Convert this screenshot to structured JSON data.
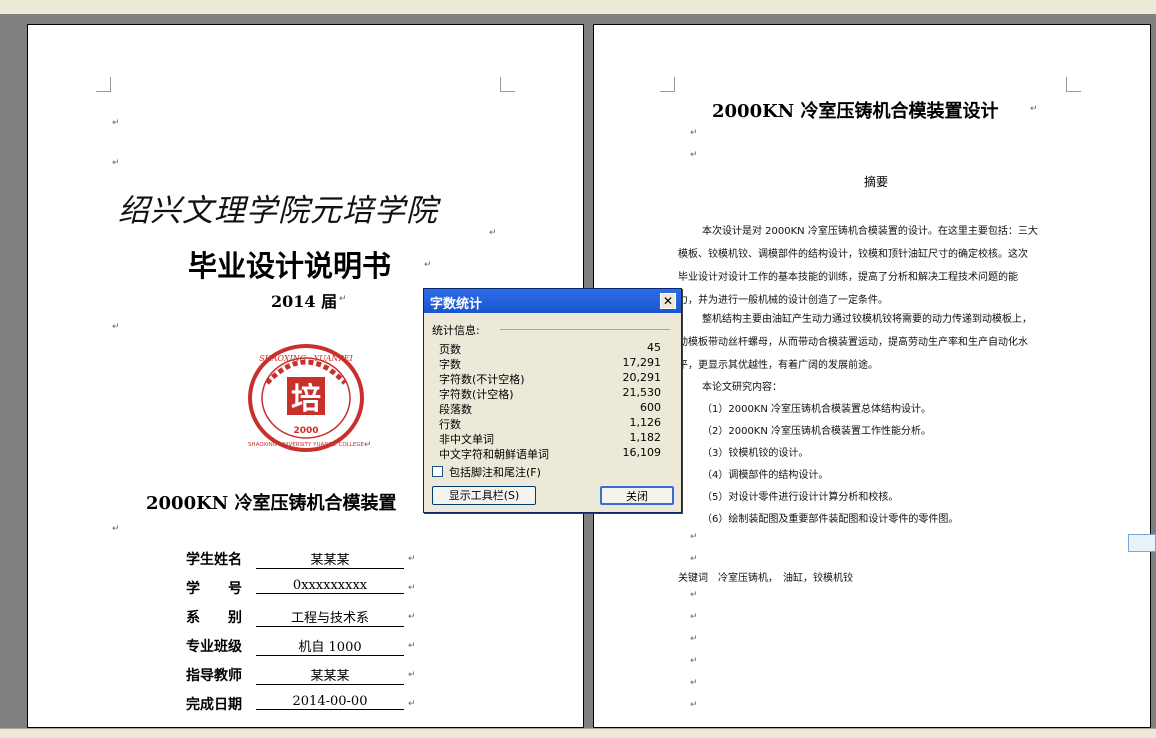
{
  "left_page": {
    "school_name": "绍兴文理学院元培学院",
    "doc_title": "毕业设计说明书",
    "year_label": "2014 届",
    "seal_text": "SHAOXING UNIVERSITY YUANPEI COLLEGE",
    "seal_year": "2000",
    "thesis_title": "2000KN 冷室压铸机合模装置",
    "info": [
      {
        "label": "学生姓名",
        "value": "某某某"
      },
      {
        "label": "学　　号",
        "value": "0xxxxxxxxx"
      },
      {
        "label": "系　　别",
        "value": "工程与技术系"
      },
      {
        "label": "专业班级",
        "value": "机自 1000"
      },
      {
        "label": "指导教师",
        "value": "某某某"
      },
      {
        "label": "完成日期",
        "value": "2014-00-00"
      }
    ]
  },
  "right_page": {
    "title": "2000KN 冷室压铸机合模装置设计",
    "abstract_heading": "摘要",
    "lines": [
      "本次设计是对 2000KN 冷室压铸机合模装置的设计。在这里主要包括：三大",
      "模板、铰模机铰、调模部件的结构设计，铰模和顶针油缸尺寸的确定校核。这次",
      "毕业设计对设计工作的基本技能的训练，提高了分析和解决工程技术问题的能",
      "力，并为进行一般机械的设计创造了一定条件。",
      "整机结构主要由油缸产生动力通过铰模机铰将需要的动力传递到动模板上，",
      "动模板带动丝杆螺母，从而带动合模装置运动，提高劳动生产率和生产自动化水",
      "平，更显示其优越性，有着广阔的发展前途。",
      "本论文研究内容：",
      "（1）2000KN 冷室压铸机合模装置总体结构设计。",
      "（2）2000KN 冷室压铸机合模装置工作性能分析。",
      "（3）铰模机铰的设计。",
      "（4）调模部件的结构设计。",
      "（5）对设计零件进行设计计算分析和校核。",
      "（6）绘制装配图及重要部件装配图和设计零件的零件图。"
    ],
    "keywords": "关键词　冷室压铸机，　油缸，铰模机铰"
  },
  "dialog": {
    "title": "字数统计",
    "group_label": "统计信息:",
    "stats": [
      {
        "label": "页数",
        "value": "45"
      },
      {
        "label": "字数",
        "value": "17,291"
      },
      {
        "label": "字符数(不计空格)",
        "value": "20,291"
      },
      {
        "label": "字符数(计空格)",
        "value": "21,530"
      },
      {
        "label": "段落数",
        "value": "600"
      },
      {
        "label": "行数",
        "value": "1,126"
      },
      {
        "label": "非中文单词",
        "value": "1,182"
      },
      {
        "label": "中文字符和朝鲜语单词",
        "value": "16,109"
      }
    ],
    "checkbox_label": "包括脚注和尾注(F)",
    "checkbox_checked": false,
    "toolbar_button": "显示工具栏(S)",
    "close_button": "关闭"
  },
  "colors": {
    "seal_red": "#c8302c",
    "title_bar_blue": "#2f6ee8"
  }
}
